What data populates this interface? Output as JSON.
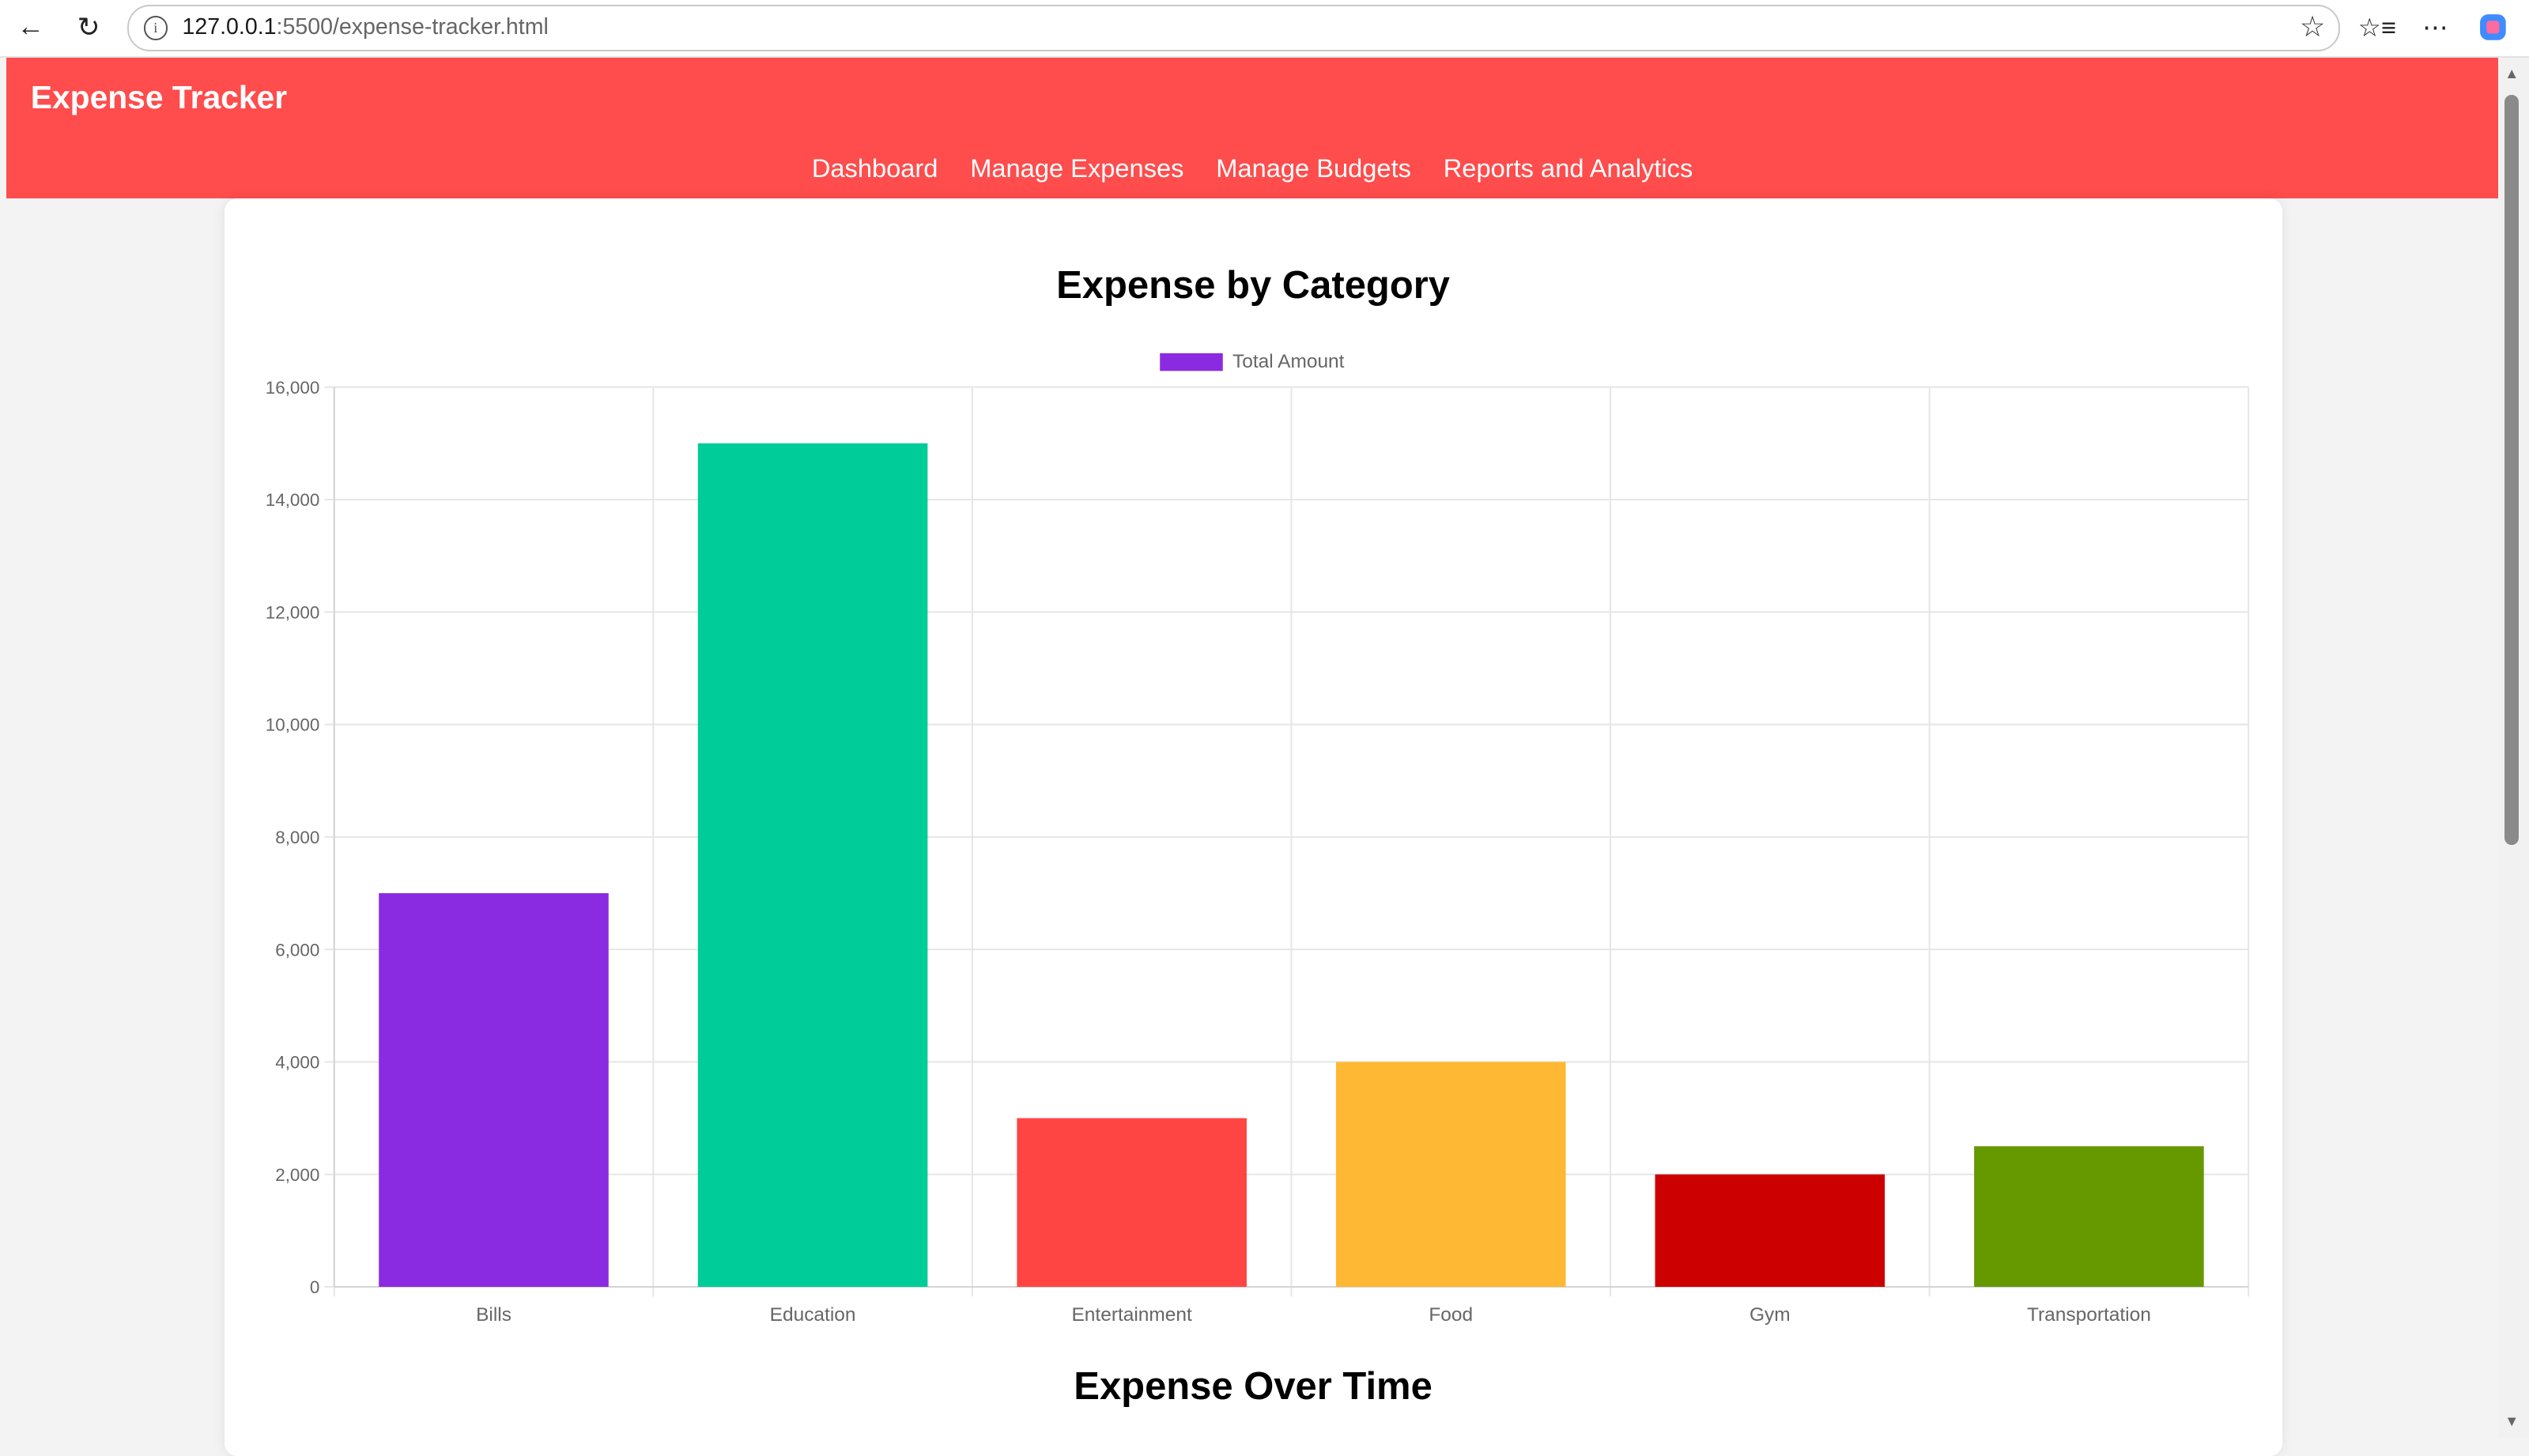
{
  "browser": {
    "url_host": "127.0.0.1",
    "url_rest": ":5500/expense-tracker.html"
  },
  "app": {
    "title": "Expense Tracker",
    "nav": [
      "Dashboard",
      "Manage Expenses",
      "Manage Budgets",
      "Reports and Analytics"
    ],
    "colors": {
      "header": "#ff4c4c"
    }
  },
  "chart_data": {
    "type": "bar",
    "title": "Expense by Category",
    "categories": [
      "Bills",
      "Education",
      "Entertainment",
      "Food",
      "Gym",
      "Transportation"
    ],
    "series": [
      {
        "name": "Total Amount",
        "values": [
          7000,
          15000,
          3000,
          4000,
          2000,
          2500
        ]
      }
    ],
    "bar_colors": [
      "#8a2be2",
      "#00cc99",
      "#ff4444",
      "#ffb833",
      "#cc0000",
      "#669900"
    ],
    "yticks": [
      "0",
      "2,000",
      "4,000",
      "6,000",
      "8,000",
      "10,000",
      "12,000",
      "14,000",
      "16,000"
    ],
    "ylim": [
      0,
      16000
    ],
    "grid": true,
    "legend": "top-center"
  },
  "next_section": {
    "title": "Expense Over Time"
  }
}
